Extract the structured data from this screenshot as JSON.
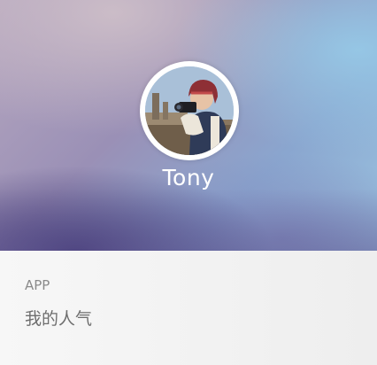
{
  "profile": {
    "username": "Tony",
    "avatar_icon": "user-photo-avatar"
  },
  "info": {
    "app_label": "APP",
    "popularity_label": "我的人气"
  },
  "colors": {
    "banner_blue": "#9cc6e2",
    "banner_purple": "#7a6aa8",
    "panel_bg": "#f1f1f1",
    "label_gray": "#8a8a8a"
  }
}
